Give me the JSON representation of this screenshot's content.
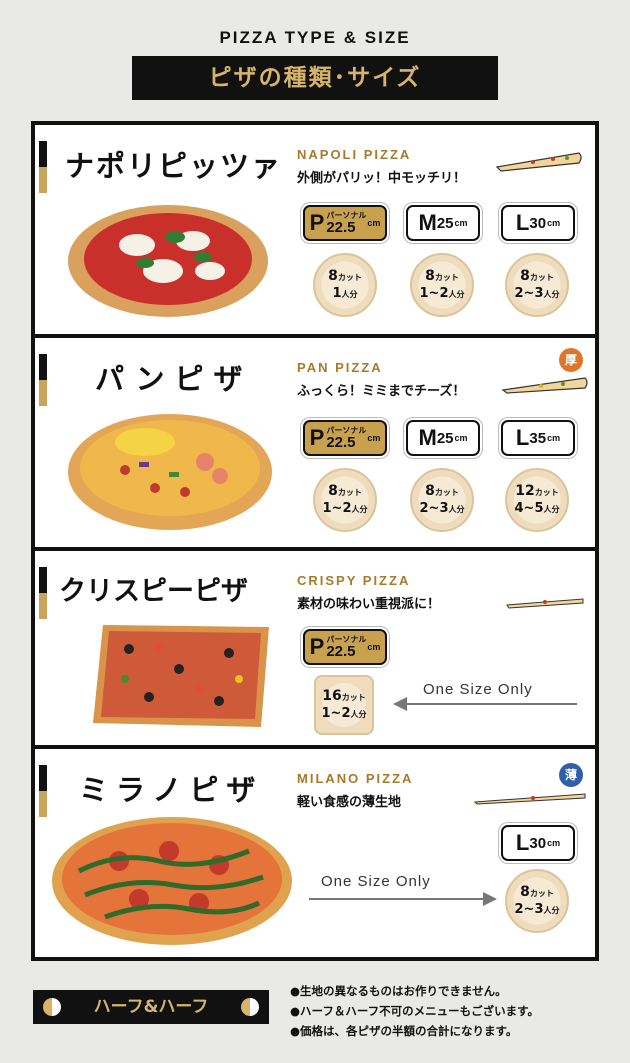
{
  "header": {
    "title_en": "PIZZA TYPE & SIZE",
    "title_jp": "ピザの種類･サイズ"
  },
  "pizzas": [
    {
      "jp_name": "ナポリピッツァ",
      "en_name": "NAPOLI PIZZA",
      "tagline": "外側がパリッ！中モッチリ！",
      "sizes": [
        {
          "letter": "P",
          "prefix": "パーソナル",
          "value": "22.5",
          "unit": "cm"
        },
        {
          "letter": "M",
          "value": "25",
          "unit": "cm"
        },
        {
          "letter": "L",
          "value": "30",
          "unit": "cm"
        }
      ],
      "slices": [
        {
          "cuts": "8",
          "cut_unit": "カット",
          "people": "1",
          "people_unit": "人分"
        },
        {
          "cuts": "8",
          "cut_unit": "カット",
          "people": "1~2",
          "people_unit": "人分"
        },
        {
          "cuts": "8",
          "cut_unit": "カット",
          "people": "2~3",
          "people_unit": "人分"
        }
      ]
    },
    {
      "jp_name": "パンピザ",
      "en_name": "PAN PIZZA",
      "tagline": "ふっくら！ミミまでチーズ！",
      "badge": "厚",
      "sizes": [
        {
          "letter": "P",
          "prefix": "パーソナル",
          "value": "22.5",
          "unit": "cm"
        },
        {
          "letter": "M",
          "value": "25",
          "unit": "cm"
        },
        {
          "letter": "L",
          "value": "35",
          "unit": "cm"
        }
      ],
      "slices": [
        {
          "cuts": "8",
          "cut_unit": "カット",
          "people": "1~2",
          "people_unit": "人分"
        },
        {
          "cuts": "8",
          "cut_unit": "カット",
          "people": "2~3",
          "people_unit": "人分"
        },
        {
          "cuts": "12",
          "cut_unit": "カット",
          "people": "4~5",
          "people_unit": "人分"
        }
      ]
    },
    {
      "jp_name": "クリスピーピザ",
      "en_name": "CRISPY PIZZA",
      "tagline": "素材の味わい重視派に！",
      "sizes": [
        {
          "letter": "P",
          "prefix": "パーソナル",
          "value": "22.5",
          "unit": "cm"
        }
      ],
      "slices": [
        {
          "cuts": "16",
          "cut_unit": "カット",
          "people": "1~2",
          "people_unit": "人分"
        }
      ],
      "one_size": "One Size Only"
    },
    {
      "jp_name": "ミラノピザ",
      "en_name": "MILANO PIZZA",
      "tagline": "軽い食感の薄生地",
      "badge": "薄",
      "sizes": [
        {
          "letter": "L",
          "value": "30",
          "unit": "cm"
        }
      ],
      "slices": [
        {
          "cuts": "8",
          "cut_unit": "カット",
          "people": "2~3",
          "people_unit": "人分"
        }
      ],
      "one_size": "One Size Only"
    }
  ],
  "footer": {
    "half_label": "ハーフ&ハーフ",
    "notes": [
      "●生地の異なるものはお作りできません。",
      "●ハーフ＆ハーフ不可のメニューもございます。",
      "●価格は、各ピザの半額の合計になります。"
    ]
  },
  "colors": {
    "gold": "#c7a14e",
    "badge_thick": "#e0752a",
    "badge_thin": "#2f5fa8"
  }
}
